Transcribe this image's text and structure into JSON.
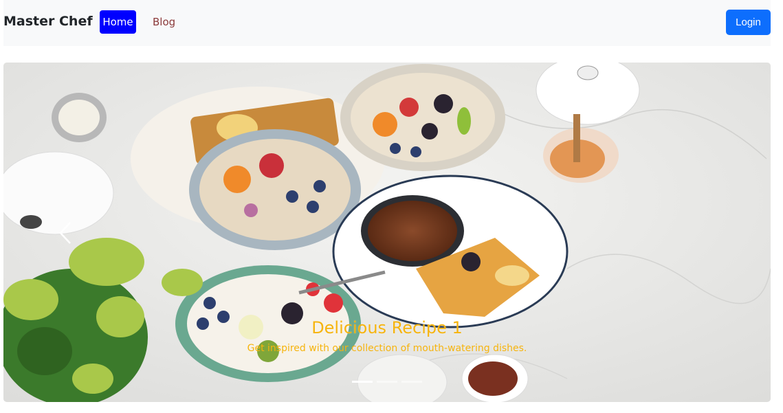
{
  "navbar": {
    "brand": "Master Chef",
    "links": [
      {
        "label": "Home",
        "active": true
      },
      {
        "label": "Blog",
        "active": false
      }
    ],
    "login_label": "Login"
  },
  "carousel": {
    "slide": {
      "title": "Delicious Recipe 1",
      "text": "Get inspired with our collection of mouth-watering dishes."
    },
    "indicator_count": 3,
    "active_index": 0
  },
  "colors": {
    "navbar_bg": "#f8f9fa",
    "home_active": "#0000ff",
    "login": "#0d6efd",
    "caption": "#f6b40e"
  }
}
